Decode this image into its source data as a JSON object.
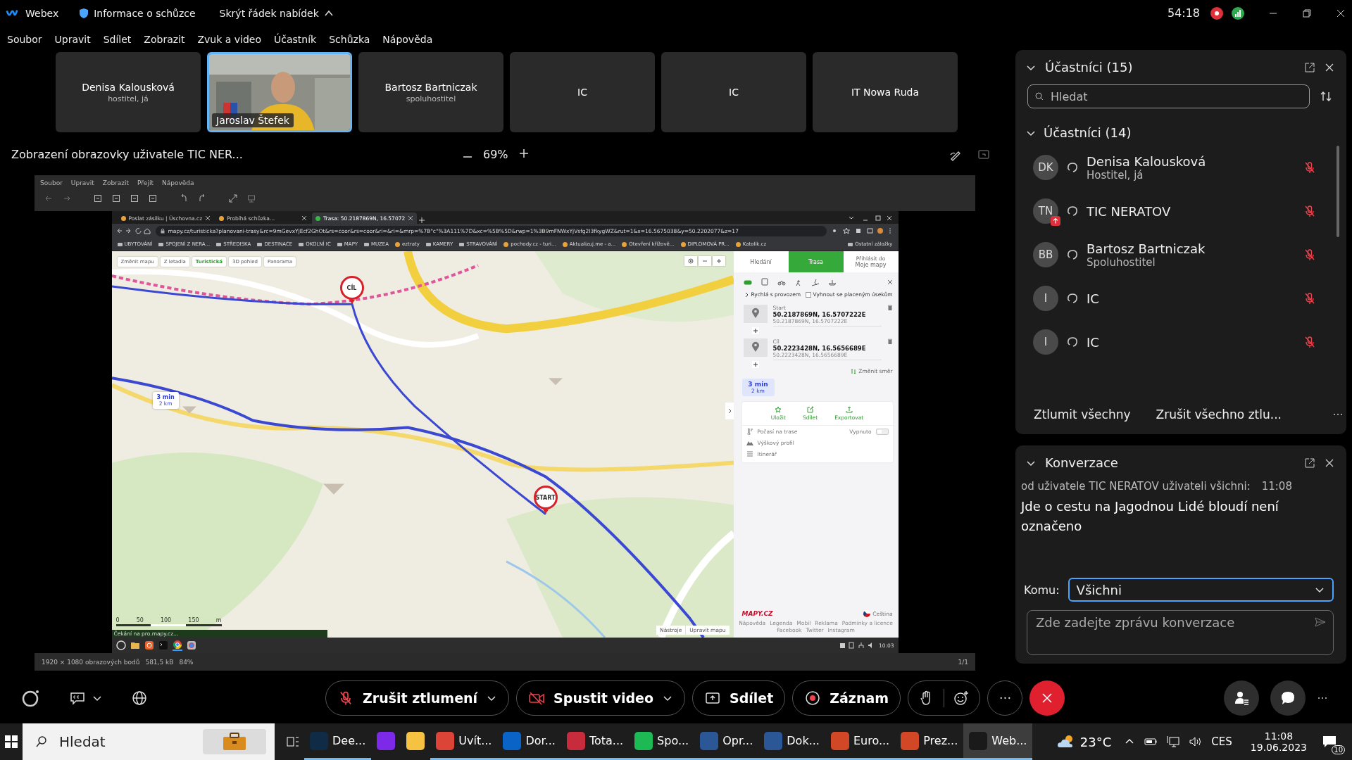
{
  "app_bar": {
    "app_name": "Webex",
    "meeting_info": "Informace o schůzce",
    "hide_menu": "Skrýt řádek nabídek",
    "timer": "54:18"
  },
  "menu": [
    "Soubor",
    "Upravit",
    "Sdílet",
    "Zobrazit",
    "Zvuk a video",
    "Účastník",
    "Schůzka",
    "Nápověda"
  ],
  "video_strip": [
    {
      "kind": "name",
      "name": "Denisa Kalousková",
      "role": "hostitel, já",
      "selected": false
    },
    {
      "kind": "video",
      "name": "Jaroslav Štefek",
      "selected": true
    },
    {
      "kind": "name",
      "name": "Bartosz Bartniczak",
      "role": "spoluhostitel",
      "selected": false
    },
    {
      "kind": "name",
      "name": "IC",
      "selected": false
    },
    {
      "kind": "name",
      "name": "IC",
      "selected": false
    },
    {
      "kind": "name",
      "name": "IT Nowa Ruda",
      "selected": false
    }
  ],
  "share": {
    "title": "Zobrazení obrazovky uživatele TIC NER...",
    "zoom": "69%"
  },
  "viewer": {
    "menu": [
      "Soubor",
      "Upravit",
      "Zobrazit",
      "Přejít",
      "Nápověda"
    ],
    "status": [
      "1920 × 1080 obrazových bodů",
      "581,5 kB",
      "84%"
    ],
    "page": "1/1"
  },
  "browser": {
    "tabs": [
      {
        "title": "Poslat zásilku | Úschovna.cz",
        "selected": false
      },
      {
        "title": "Probíhá schůzka...",
        "selected": false
      },
      {
        "title": "Trasa: 50.2187869N, 16.57072",
        "selected": true
      }
    ],
    "url": "mapy.cz/turisticka?planovani-trasy&rc=9mGevxYjEcf2GhOt&rs=coor&rs=coor&ri=&ri=&mrp=%7B\"c\"%3A111%7D&xc=%5B%5D&rwp=1%3B9mFNWxYjVsfg2I3fkygWZ&rut=1&x=16.5675038&y=50.2202077&z=17",
    "bookmarks": [
      {
        "kind": "folder",
        "label": "UBYTOVÁNÍ"
      },
      {
        "kind": "folder",
        "label": "SPOJENÍ Z NERA..."
      },
      {
        "kind": "folder",
        "label": "STŘEDISKA"
      },
      {
        "kind": "folder",
        "label": "DESTINACE"
      },
      {
        "kind": "folder",
        "label": "OKOLNÍ IC"
      },
      {
        "kind": "folder",
        "label": "MAPY"
      },
      {
        "kind": "folder",
        "label": "MUZEA"
      },
      {
        "kind": "site",
        "label": "eztraty"
      },
      {
        "kind": "folder",
        "label": "KAMERY"
      },
      {
        "kind": "folder",
        "label": "STRAVOVÁNÍ"
      },
      {
        "kind": "site",
        "label": "pochody.cz - turi..."
      },
      {
        "kind": "site",
        "label": "Aktualizuj.me - a..."
      },
      {
        "kind": "site",
        "label": "Otevření křížově..."
      },
      {
        "kind": "site",
        "label": "DIPLOMOVÁ PR..."
      },
      {
        "kind": "site",
        "label": "Katolik.cz"
      }
    ],
    "other_bookmarks": "Ostatní záložky"
  },
  "map": {
    "layers": [
      {
        "label": "Změnit mapu",
        "selected": false
      },
      {
        "label": "Z letadla",
        "selected": false
      },
      {
        "label": "Turistická",
        "selected": true
      },
      {
        "label": "3D pohled",
        "selected": false
      },
      {
        "label": "Panorama",
        "selected": false
      }
    ],
    "pins": [
      {
        "label": "CÍL"
      },
      {
        "label": "START"
      }
    ],
    "route_badge": {
      "time": "3 min",
      "distance": "2 km"
    },
    "scale": [
      "0",
      "50",
      "100",
      "150",
      "m"
    ],
    "tools": [
      "Nástroje",
      "Upravit mapu"
    ],
    "status": "Čekání na pro.mapy.cz..."
  },
  "route_panel": {
    "tabs": [
      {
        "label": "Hledání",
        "selected": false
      },
      {
        "label": "Trasa",
        "selected": true
      },
      {
        "label": "Moje mapy",
        "sublabel": "Přihlásit do",
        "selected": false
      }
    ],
    "modes": [
      {
        "kind": "car",
        "selected": true
      },
      {
        "kind": "bus",
        "selected": false
      },
      {
        "kind": "bike",
        "selected": false
      },
      {
        "kind": "walk",
        "selected": false
      },
      {
        "kind": "ski",
        "selected": false
      },
      {
        "kind": "boat",
        "selected": false
      }
    ],
    "fast": "Rychlá s provozem",
    "avoid_toll": {
      "label": "Vyhnout se placeným úsekům",
      "checked": false
    },
    "waypoints": [
      {
        "label": "Start",
        "title": "50.2187869N, 16.5707222E",
        "subtitle": "50.2187869N, 16.5707222E"
      },
      {
        "label": "Cíl",
        "title": "50.2223428N, 16.5656689E",
        "subtitle": "50.2223428N, 16.5656689E"
      }
    ],
    "reverse": "Změnit směr",
    "result": {
      "time": "3 min",
      "distance": "2 km"
    },
    "actions": [
      {
        "kind": "save",
        "label": "Uložit"
      },
      {
        "kind": "share",
        "label": "Sdílet"
      },
      {
        "kind": "export",
        "label": "Exportovat"
      }
    ],
    "extras": [
      {
        "kind": "weather",
        "label": "Počasí na trase",
        "value": "Vypnuto",
        "on": false
      },
      {
        "kind": "profile",
        "label": "Výškový profil"
      },
      {
        "kind": "itinerary",
        "label": "Itinerář"
      }
    ],
    "logo": "MAPY.CZ",
    "language": "Čeština",
    "footer_links": [
      "Nápověda",
      "Legenda",
      "Mobil",
      "Reklama",
      "Podmínky a licence",
      "Facebook",
      "Twitter",
      "Instagram"
    ]
  },
  "linux_clock": "10:03",
  "controls": {
    "unmute": "Zrušit ztlumení",
    "video": "Spustit video",
    "share": "Sdílet",
    "record": "Záznam"
  },
  "participants_panel": {
    "title": "Účastníci (15)",
    "search": {
      "placeholder": "Hledat"
    },
    "group": "Účastníci (14)",
    "people": [
      {
        "initials": "DK",
        "name": "Denisa Kalousková",
        "role": "Hostitel, já",
        "sharing": false,
        "muted": true
      },
      {
        "initials": "TN",
        "name": "TIC NERATOV",
        "sharing": true,
        "muted": true
      },
      {
        "initials": "BB",
        "name": "Bartosz Bartniczak",
        "role": "Spoluhostitel",
        "sharing": false,
        "muted": true
      },
      {
        "initials": "I",
        "name": "IC",
        "sharing": false,
        "muted": true
      },
      {
        "initials": "I",
        "name": "IC",
        "sharing": false,
        "muted": true
      }
    ],
    "mute_all": "Ztlumit všechny",
    "unmute_all": "Zrušit všechno ztlu..."
  },
  "chat": {
    "title": "Konverzace",
    "messages": [
      {
        "from": "od uživatele TIC NERATOV uživateli všichni:",
        "time": "11:08",
        "text": "Jde o cestu na Jagodnou Lidé bloudí není označeno"
      }
    ],
    "to_label": "Komu:",
    "to_value": "Všichni",
    "composer": {
      "placeholder": "Zde zadejte zprávu konverzace"
    }
  },
  "taskbar": {
    "search": {
      "placeholder": "Hledat"
    },
    "apps": [
      {
        "kind": "deepl",
        "label": "Dee...",
        "selected": false
      },
      {
        "kind": "canva",
        "selected": false
      },
      {
        "kind": "explorer",
        "selected": false
      },
      {
        "kind": "chrome",
        "label": "Uvít...",
        "selected": false
      },
      {
        "kind": "outlook",
        "label": "Dor...",
        "selected": false
      },
      {
        "kind": "doc",
        "label": "Tota...",
        "selected": false
      },
      {
        "kind": "spotify",
        "label": "Spo...",
        "selected": false
      },
      {
        "kind": "word",
        "label": "Opr...",
        "selected": false
      },
      {
        "kind": "word",
        "label": "Dok...",
        "selected": false
      },
      {
        "kind": "powerpoint",
        "label": "Euro...",
        "selected": false
      },
      {
        "kind": "powerpoint",
        "label": "Prez...",
        "selected": false
      },
      {
        "kind": "webex",
        "label": "Web...",
        "selected": true
      }
    ],
    "temperature": "23°C",
    "language": "CES",
    "time": "11:08",
    "date": "19.06.2023",
    "notifications": "10"
  }
}
